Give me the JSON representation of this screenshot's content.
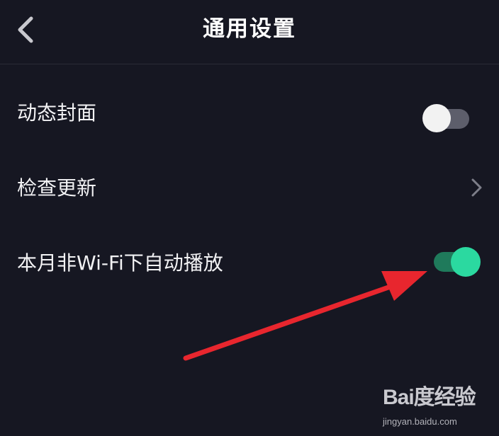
{
  "header": {
    "title": "通用设置",
    "back_icon": "chevron-left-icon"
  },
  "settings": [
    {
      "label": "动态封面",
      "control": "toggle",
      "state": "off"
    },
    {
      "label": "检查更新",
      "control": "chevron",
      "icon": "chevron-right-icon"
    },
    {
      "label": "本月非Wi-Fi下自动播放",
      "control": "toggle",
      "state": "on"
    }
  ],
  "watermark": {
    "logo": "Bai度经验",
    "url": "jingyan.baidu.com"
  },
  "colors": {
    "background": "#161722",
    "toggle_on_knob": "#2bd9a0",
    "toggle_on_track": "#1f7a5b",
    "toggle_off_knob": "#f2f2f2",
    "toggle_off_track": "#5d5e6b",
    "annotation_arrow": "#e8262e"
  }
}
